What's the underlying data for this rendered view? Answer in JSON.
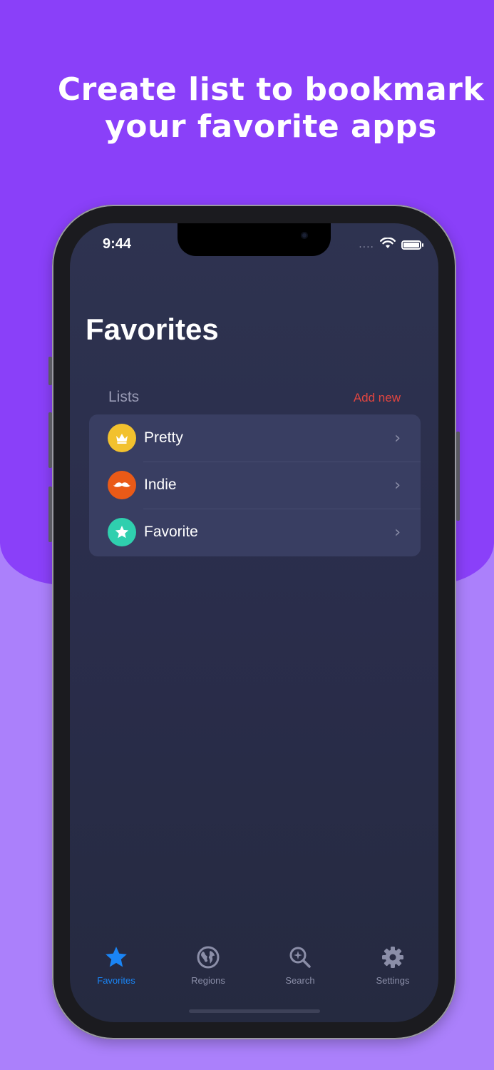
{
  "headline": {
    "line1": "Create list to bookmark",
    "line2": "your favorite apps"
  },
  "status_bar": {
    "time": "9:44",
    "signal": "....",
    "icons": [
      "wifi-icon",
      "battery-icon"
    ]
  },
  "page": {
    "title": "Favorites"
  },
  "lists_section": {
    "title": "Lists",
    "add_new": "Add new",
    "items": [
      {
        "label": "Pretty",
        "icon": "crown-icon",
        "color": "#f2c12e"
      },
      {
        "label": "Indie",
        "icon": "mustache-icon",
        "color": "#ea5a17"
      },
      {
        "label": "Favorite",
        "icon": "star-icon",
        "color": "#2fcfae"
      }
    ]
  },
  "tabbar": {
    "tabs": [
      {
        "label": "Favorites",
        "icon": "star-icon",
        "active": true
      },
      {
        "label": "Regions",
        "icon": "globe-icon",
        "active": false
      },
      {
        "label": "Search",
        "icon": "search-sparkle-icon",
        "active": false
      },
      {
        "label": "Settings",
        "icon": "gear-icon",
        "active": false
      }
    ]
  },
  "colors": {
    "background_top": "#8a40f9",
    "background_bottom": "#ab80fb",
    "screen_bg": "#2a2d4b",
    "card_bg": "#393e62",
    "accent_red": "#e24540",
    "active_tab": "#1a84f5",
    "inactive_tab": "#8b8ea8"
  }
}
